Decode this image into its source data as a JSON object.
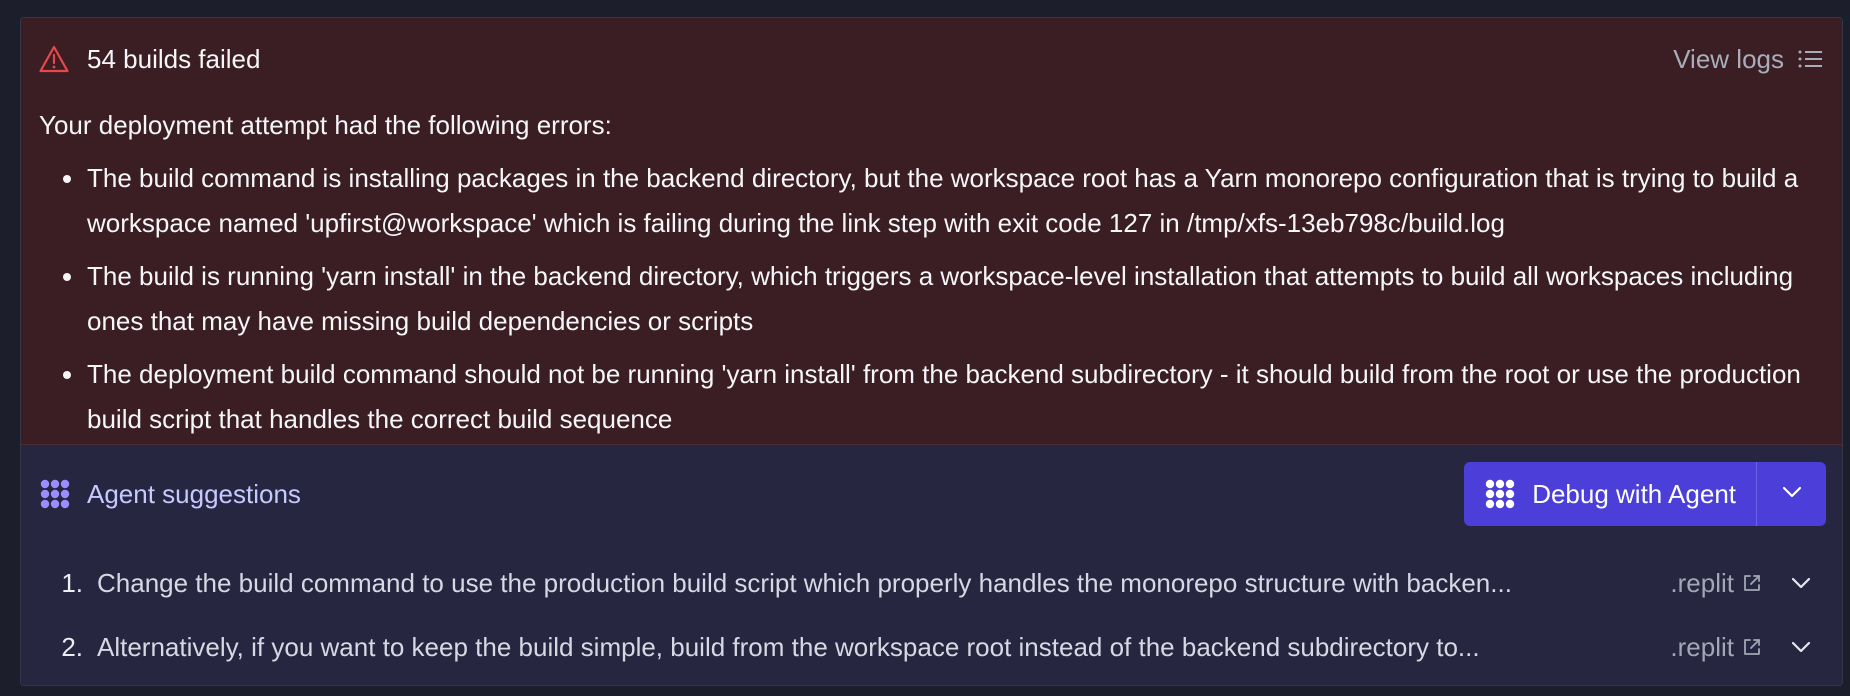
{
  "error": {
    "title": "54 builds failed",
    "view_logs_label": "View logs",
    "intro": "Your deployment attempt had the following errors:",
    "items": [
      "The build command is installing packages in the backend directory, but the workspace root has a Yarn monorepo configuration that is trying to build a workspace named 'upfirst@workspace' which is failing during the link step with exit code 127 in /tmp/xfs-13eb798c/build.log",
      "The build is running 'yarn install' in the backend directory, which triggers a workspace-level installation that attempts to build all workspaces including ones that may have missing build dependencies or scripts",
      "The deployment build command should not be running 'yarn install' from the backend subdirectory - it should build from the root or use the production build script that handles the correct build sequence"
    ]
  },
  "agent": {
    "title": "Agent suggestions",
    "debug_label": "Debug with Agent",
    "suggestions": [
      {
        "number": "1.",
        "text": "Change the build command to use the production build script which properly handles the monorepo structure with backen...",
        "file": ".replit"
      },
      {
        "number": "2.",
        "text": "Alternatively, if you want to keep the build simple, build from the workspace root instead of the backend subdirectory to...",
        "file": ".replit"
      }
    ]
  },
  "colors": {
    "error_bg": "#3a1e24",
    "agent_bg": "#262640",
    "accent": "#4c3ed8",
    "warning": "#e5484d"
  },
  "icons": {
    "warning": "warning-triangle-icon",
    "logs": "list-icon",
    "agent": "agent-logo-icon",
    "external": "external-link-icon",
    "chevron": "chevron-down-icon"
  }
}
